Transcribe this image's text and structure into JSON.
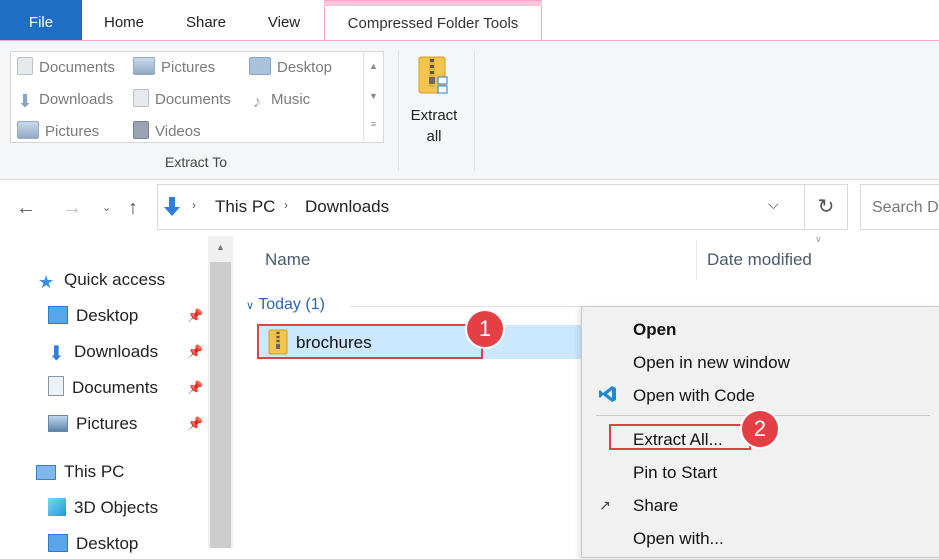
{
  "ribbon": {
    "tabs": [
      {
        "label": "File"
      },
      {
        "label": "Home"
      },
      {
        "label": "Share"
      },
      {
        "label": "View"
      },
      {
        "label": "Compressed Folder Tools"
      }
    ],
    "extract_to": {
      "group_label": "Extract To",
      "items": [
        "Documents",
        "Pictures",
        "Desktop",
        "Downloads",
        "Documents",
        "Music",
        "Pictures",
        "Videos"
      ]
    },
    "extract_all_label": "Extract all"
  },
  "address_bar": {
    "crumbs": [
      "This PC",
      "Downloads"
    ],
    "search_placeholder": "Search D"
  },
  "nav_pane": {
    "quick_access": "Quick access",
    "items": [
      "Desktop",
      "Downloads",
      "Documents",
      "Pictures"
    ],
    "this_pc": "This PC",
    "pc_items": [
      "3D Objects",
      "Desktop"
    ]
  },
  "file_list": {
    "columns": {
      "name": "Name",
      "date": "Date modified"
    },
    "group": "Today (1)",
    "files": [
      {
        "name": "brochures"
      }
    ]
  },
  "context_menu": {
    "items": [
      "Open",
      "Open in new window",
      "Open with Code",
      "Extract All...",
      "Pin to Start",
      "Share",
      "Open with..."
    ]
  },
  "annotations": {
    "badge1": "1",
    "badge2": "2"
  },
  "colors": {
    "accent": "#1e6fc4",
    "highlight": "#e04046",
    "selection": "#cce8ff",
    "compressed_tab": "#f6c5db"
  }
}
